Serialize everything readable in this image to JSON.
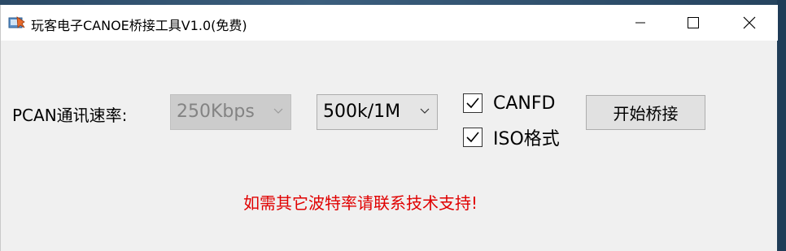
{
  "window": {
    "title": "玩客电子CANOE桥接工具V1.0(免费)"
  },
  "form": {
    "rate_label": "PCAN通讯速率:",
    "rate_combo_value": "250Kbps",
    "canfd_rate_value": "500k/1M",
    "canfd_checkbox_label": "CANFD",
    "canfd_checked": true,
    "iso_checkbox_label": "ISO格式",
    "iso_checked": true,
    "start_button_label": "开始桥接",
    "notice": "如需其它波特率请联系技术支持!"
  },
  "colors": {
    "notice": "#e00000",
    "window_bg": "#f0f0f0"
  },
  "icons": {
    "app": "app-icon",
    "minimize": "minimize-icon",
    "maximize": "maximize-icon",
    "close": "close-icon"
  }
}
